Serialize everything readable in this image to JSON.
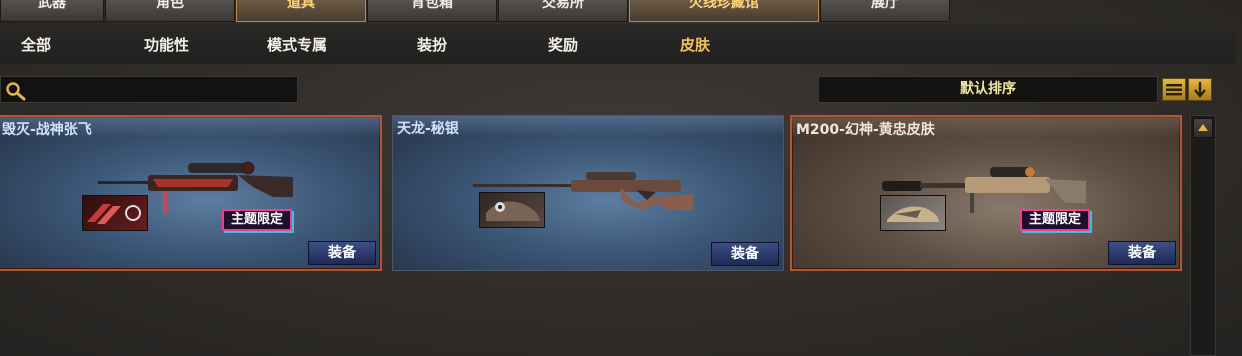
{
  "top_tabs": [
    {
      "label": "武器"
    },
    {
      "label": "角色"
    },
    {
      "label": "道具"
    },
    {
      "label": "背包箱"
    },
    {
      "label": "交易所"
    },
    {
      "label": "火线珍藏馆"
    },
    {
      "label": "展厅"
    }
  ],
  "sub_tabs": [
    {
      "label": "全部"
    },
    {
      "label": "功能性"
    },
    {
      "label": "模式专属"
    },
    {
      "label": "装扮"
    },
    {
      "label": "奖励"
    },
    {
      "label": "皮肤"
    }
  ],
  "search": {
    "value": "",
    "icon": "search-icon"
  },
  "sort": {
    "label": "默认排序",
    "list_icon": "list-icon",
    "order_icon": "sort-down-arrow-icon"
  },
  "cards": [
    {
      "title": "毁灭-战神张飞",
      "badge": "主题限定",
      "equip_label": "装备"
    },
    {
      "title": "天龙-秘银",
      "equip_label": "装备"
    },
    {
      "title": "M200-幻神-黄忠皮肤",
      "badge": "主题限定",
      "equip_label": "装备"
    }
  ],
  "colors": {
    "active_tab": "#f2c25b",
    "card_border_red": "#b25530",
    "equip_button": "#2c3a6e"
  }
}
